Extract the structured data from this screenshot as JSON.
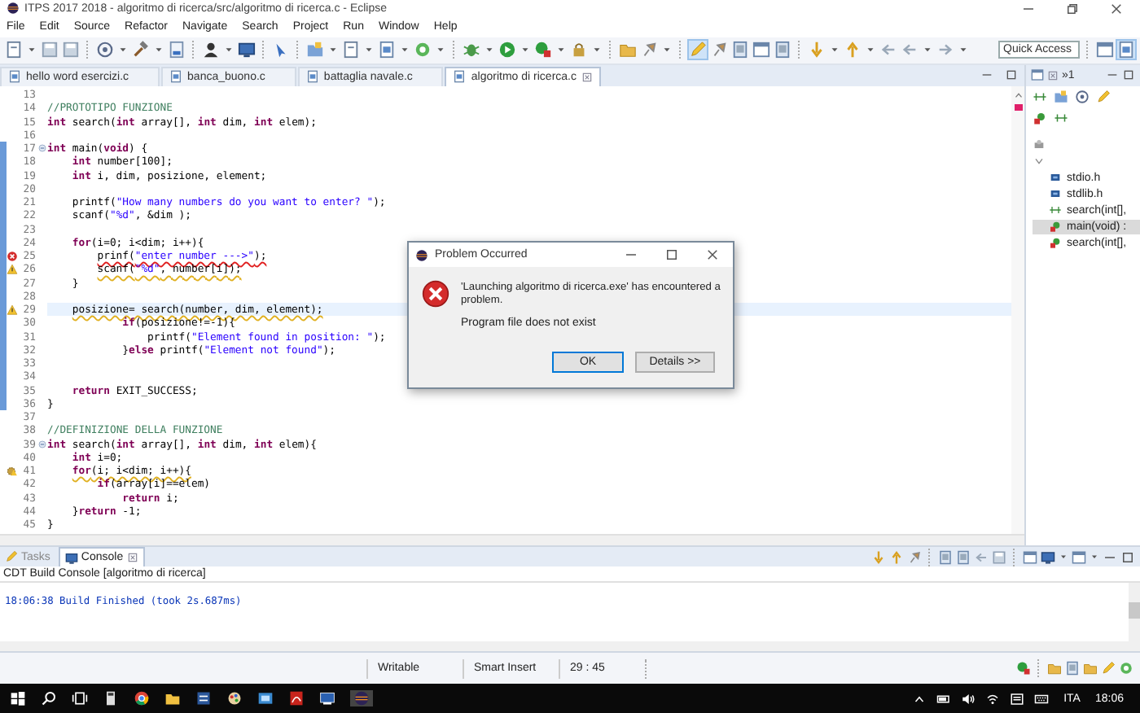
{
  "window": {
    "title": "ITPS 2017 2018 - algoritmo di ricerca/src/algoritmo di ricerca.c - Eclipse"
  },
  "menu": [
    "File",
    "Edit",
    "Source",
    "Refactor",
    "Navigate",
    "Search",
    "Project",
    "Run",
    "Window",
    "Help"
  ],
  "toolbar": {
    "quick_access": {
      "placeholder": "Quick Access"
    }
  },
  "editor_tabs": [
    {
      "label": "hello word esercizi.c",
      "selected": false
    },
    {
      "label": "banca_buono.c",
      "selected": false
    },
    {
      "label": "battaglia navale.c",
      "selected": false
    },
    {
      "label": "algoritmo di ricerca.c",
      "selected": true
    }
  ],
  "code_lines": [
    {
      "n": "13"
    },
    {
      "n": "14",
      "segments": [
        {
          "t": "//PROTOTIPO FUNZIONE",
          "kind": "comment"
        }
      ]
    },
    {
      "n": "15",
      "segments": [
        {
          "t": "int",
          "kind": "keyword"
        },
        {
          "t": " search(",
          "kind": "plain"
        },
        {
          "t": "int",
          "kind": "keyword"
        },
        {
          "t": " array[], ",
          "kind": "plain"
        },
        {
          "t": "int",
          "kind": "keyword"
        },
        {
          "t": " dim, ",
          "kind": "plain"
        },
        {
          "t": "int",
          "kind": "keyword"
        },
        {
          "t": " elem);",
          "kind": "plain"
        }
      ]
    },
    {
      "n": "16"
    },
    {
      "n": "17",
      "changed": true,
      "fold": true,
      "segments": [
        {
          "t": "int",
          "kind": "keyword"
        },
        {
          "t": " main(",
          "kind": "plain"
        },
        {
          "t": "void",
          "kind": "keyword"
        },
        {
          "t": ") {",
          "kind": "plain"
        }
      ]
    },
    {
      "n": "18",
      "changed": true,
      "segments": [
        {
          "t": "    int",
          "kind": "keyword"
        },
        {
          "t": " number[100];",
          "kind": "plain"
        }
      ]
    },
    {
      "n": "19",
      "changed": true,
      "segments": [
        {
          "t": "    int",
          "kind": "keyword"
        },
        {
          "t": " i, dim, posizione, element;",
          "kind": "plain"
        }
      ]
    },
    {
      "n": "20",
      "changed": true
    },
    {
      "n": "21",
      "changed": true,
      "segments": [
        {
          "t": "    printf(",
          "kind": "plain"
        },
        {
          "t": "\"How many numbers do you want to enter? \"",
          "kind": "string"
        },
        {
          "t": ");",
          "kind": "plain"
        }
      ]
    },
    {
      "n": "22",
      "changed": true,
      "segments": [
        {
          "t": "    scanf(",
          "kind": "plain"
        },
        {
          "t": "\"%d\"",
          "kind": "string"
        },
        {
          "t": ", &dim );",
          "kind": "plain"
        }
      ]
    },
    {
      "n": "23",
      "changed": true
    },
    {
      "n": "24",
      "changed": true,
      "segments": [
        {
          "t": "    for",
          "kind": "keyword"
        },
        {
          "t": "(i=0; i<dim; i++){",
          "kind": "plain"
        }
      ]
    },
    {
      "n": "25",
      "changed": true,
      "issue": {
        "kind": "error"
      },
      "segments": [
        {
          "t": "        prinf(",
          "kind": "plain"
        },
        {
          "t": "\"enter number --->\"",
          "kind": "string"
        },
        {
          "t": ");",
          "kind": "plain"
        }
      ]
    },
    {
      "n": "26",
      "changed": true,
      "issue": {
        "kind": "warning"
      },
      "segments": [
        {
          "t": "        scanf(",
          "kind": "plain"
        },
        {
          "t": "\"%d\"",
          "kind": "string"
        },
        {
          "t": ", number[i]);",
          "kind": "plain"
        }
      ]
    },
    {
      "n": "27",
      "changed": true,
      "segments": [
        {
          "t": "    }",
          "kind": "plain"
        }
      ]
    },
    {
      "n": "28",
      "changed": true
    },
    {
      "n": "29",
      "changed": true,
      "issue": {
        "kind": "warning"
      },
      "current": true,
      "segments": [
        {
          "t": "    posizione= search(number, dim, element);",
          "kind": "plain"
        }
      ]
    },
    {
      "n": "30",
      "changed": true,
      "segments": [
        {
          "t": "            if",
          "kind": "keyword"
        },
        {
          "t": "(posizione!=-1){",
          "kind": "plain"
        }
      ]
    },
    {
      "n": "31",
      "changed": true,
      "segments": [
        {
          "t": "                printf(",
          "kind": "plain"
        },
        {
          "t": "\"Element found in position: \"",
          "kind": "string"
        },
        {
          "t": ");",
          "kind": "plain"
        }
      ]
    },
    {
      "n": "32",
      "changed": true,
      "segments": [
        {
          "t": "            }",
          "kind": "plain"
        },
        {
          "t": "else",
          "kind": "keyword"
        },
        {
          "t": " printf(",
          "kind": "plain"
        },
        {
          "t": "\"Element not found\"",
          "kind": "string"
        },
        {
          "t": ");",
          "kind": "plain"
        }
      ]
    },
    {
      "n": "33",
      "changed": true
    },
    {
      "n": "34",
      "changed": true
    },
    {
      "n": "35",
      "changed": true,
      "segments": [
        {
          "t": "    return",
          "kind": "keyword"
        },
        {
          "t": " EXIT_SUCCESS;",
          "kind": "plain"
        }
      ]
    },
    {
      "n": "36",
      "changed": true,
      "segments": [
        {
          "t": "}",
          "kind": "plain"
        }
      ]
    },
    {
      "n": "37"
    },
    {
      "n": "38",
      "segments": [
        {
          "t": "//DEFINIZIONE DELLA FUNZIONE",
          "kind": "comment"
        }
      ]
    },
    {
      "n": "39",
      "fold": true,
      "segments": [
        {
          "t": "int",
          "kind": "keyword"
        },
        {
          "t": " search(",
          "kind": "plain"
        },
        {
          "t": "int",
          "kind": "keyword"
        },
        {
          "t": " array[], ",
          "kind": "plain"
        },
        {
          "t": "int",
          "kind": "keyword"
        },
        {
          "t": " dim, ",
          "kind": "plain"
        },
        {
          "t": "int",
          "kind": "keyword"
        },
        {
          "t": " elem){",
          "kind": "plain"
        }
      ]
    },
    {
      "n": "40",
      "segments": [
        {
          "t": "    int",
          "kind": "keyword"
        },
        {
          "t": " i=0;",
          "kind": "plain"
        }
      ]
    },
    {
      "n": "41",
      "issue": {
        "kind": "gear-warning"
      },
      "segments": [
        {
          "t": "    for",
          "kind": "keyword"
        },
        {
          "t": "(i; i<dim; i++){",
          "kind": "plain"
        }
      ]
    },
    {
      "n": "42",
      "segments": [
        {
          "t": "        if",
          "kind": "keyword"
        },
        {
          "t": "(array[i]==elem)",
          "kind": "plain"
        }
      ]
    },
    {
      "n": "43",
      "segments": [
        {
          "t": "            return",
          "kind": "keyword"
        },
        {
          "t": " i;",
          "kind": "plain"
        }
      ]
    },
    {
      "n": "44",
      "segments": [
        {
          "t": "    }",
          "kind": "plain"
        },
        {
          "t": "return",
          "kind": "keyword"
        },
        {
          "t": " -1;",
          "kind": "plain"
        }
      ]
    },
    {
      "n": "45",
      "segments": [
        {
          "t": "}",
          "kind": "plain"
        }
      ]
    }
  ],
  "outline": {
    "more_views": "»1",
    "items": [
      {
        "label": "stdio.h",
        "kind": "include",
        "selected": false
      },
      {
        "label": "stdlib.h",
        "kind": "include",
        "selected": false
      },
      {
        "label": "search(int[],",
        "kind": "declaration",
        "selected": false
      },
      {
        "label": "main(void) :",
        "kind": "function",
        "selected": true
      },
      {
        "label": "search(int[],",
        "kind": "function",
        "selected": false
      }
    ]
  },
  "console": {
    "tabs": [
      {
        "label": "Tasks",
        "selected": false
      },
      {
        "label": "Console",
        "selected": true
      }
    ],
    "header": "CDT Build Console [algoritmo di ricerca]",
    "output": [
      "18:06:38 Build Finished (took 2s.687ms)"
    ]
  },
  "status_bar": [
    "Writable",
    "Smart Insert",
    "29 : 45"
  ],
  "dialog": {
    "title": "Problem Occurred",
    "message": "'Launching algoritmo di ricerca.exe' has encountered a problem.",
    "detail": "Program file does not exist",
    "buttons": [
      {
        "label": "OK",
        "default": true
      },
      {
        "label": "Details >>",
        "default": false
      }
    ]
  },
  "taskbar": {
    "language": "ITA",
    "time": "18:06"
  }
}
